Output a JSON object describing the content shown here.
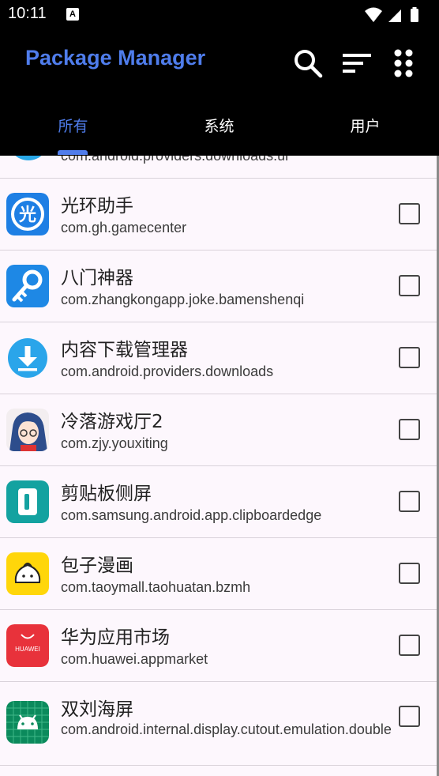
{
  "status_bar": {
    "time": "10:11",
    "notif_badge": "A"
  },
  "app_bar": {
    "title": "Package Manager",
    "icons": [
      "search-icon",
      "sort-icon",
      "more-icon"
    ]
  },
  "tabs": [
    {
      "label": "所有",
      "selected": true
    },
    {
      "label": "系统",
      "selected": false
    },
    {
      "label": "用户",
      "selected": false
    }
  ],
  "partial_row": {
    "package": "com.android.providers.downloads.ui"
  },
  "apps": [
    {
      "name": "光环助手",
      "package": "com.gh.gamecenter",
      "icon": "guanghuan-icon",
      "checked": false
    },
    {
      "name": "八门神器",
      "package": "com.zhangkongapp.joke.bamenshenqi",
      "icon": "key-icon",
      "checked": false
    },
    {
      "name": "内容下载管理器",
      "package": "com.android.providers.downloads",
      "icon": "download-icon",
      "checked": false
    },
    {
      "name": "冷落游戏厅2",
      "package": "com.zjy.youxiting",
      "icon": "anime-avatar-icon",
      "checked": false
    },
    {
      "name": "剪贴板侧屏",
      "package": "com.samsung.android.app.clipboardedge",
      "icon": "clipboard-edge-icon",
      "checked": false
    },
    {
      "name": "包子漫画",
      "package": "com.taoymall.taohuatan.bzmh",
      "icon": "baozi-icon",
      "checked": false
    },
    {
      "name": "华为应用市场",
      "package": "com.huawei.appmarket",
      "icon": "huawei-appgallery-icon",
      "icon_text": "HUAWEI",
      "checked": false
    },
    {
      "name": "双刘海屏",
      "package": "com.android.internal.display.cutout.emulation.double",
      "icon": "android-icon",
      "checked": false
    }
  ],
  "colors": {
    "accent": "#4f7dec",
    "list_bg": "#fdf7fd",
    "bar_bg": "#000000"
  }
}
